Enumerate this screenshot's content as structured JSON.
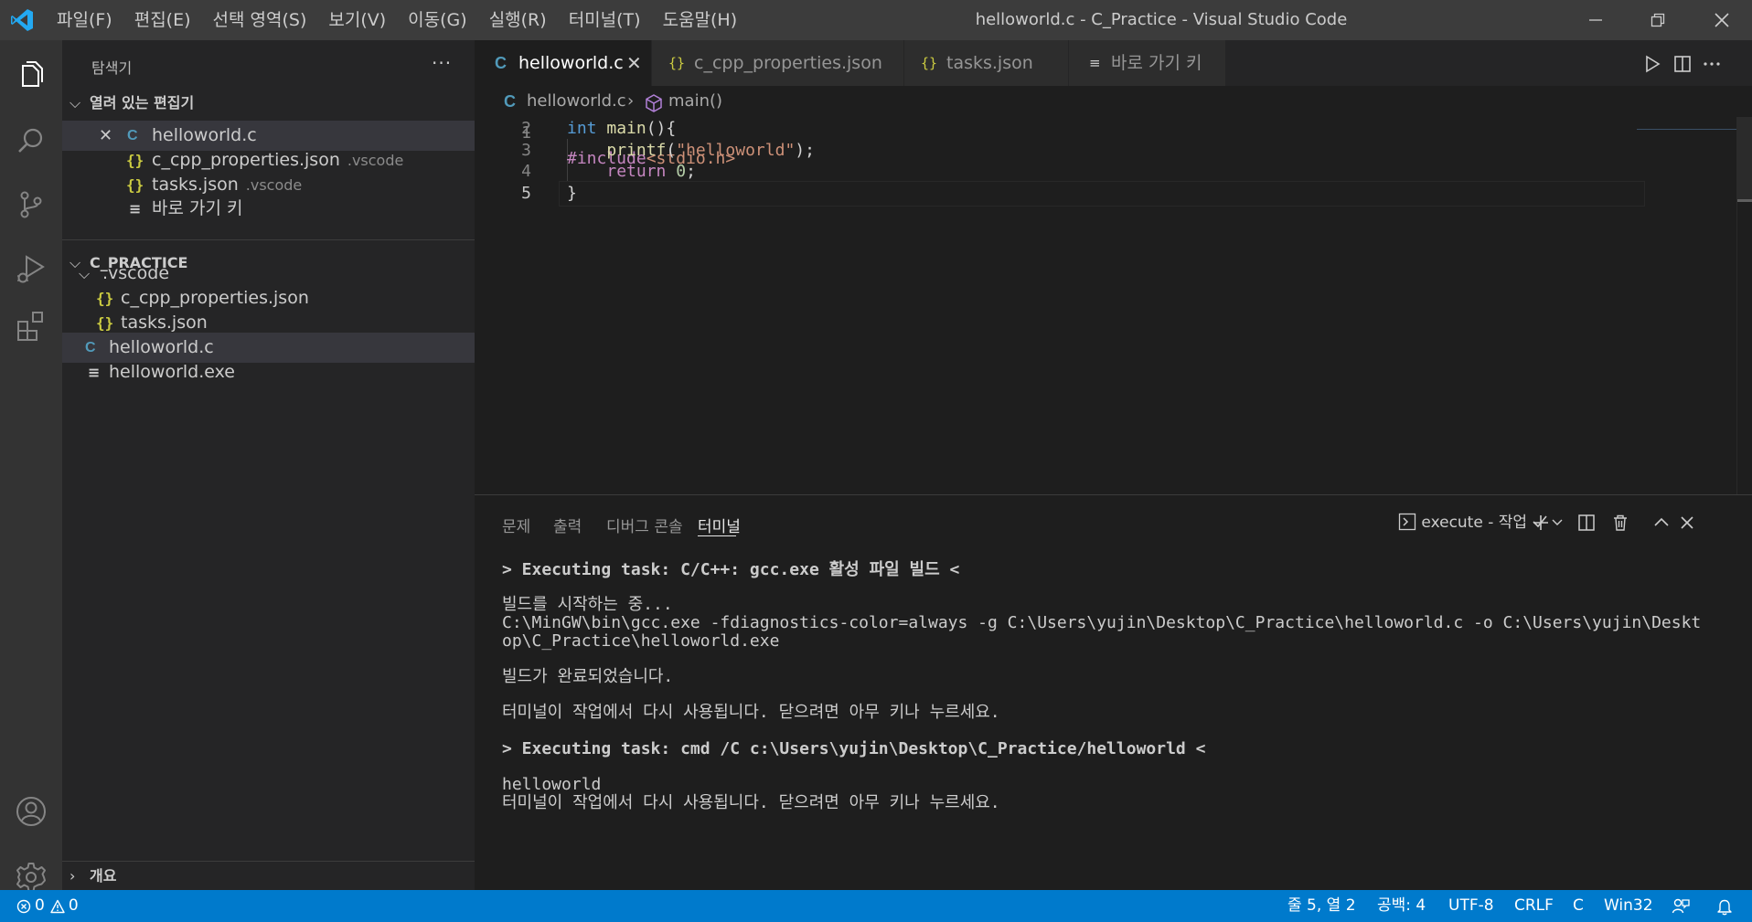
{
  "titlebar": {
    "menu": [
      "파일(F)",
      "편집(E)",
      "선택 영역(S)",
      "보기(V)",
      "이동(G)",
      "실행(R)",
      "터미널(T)",
      "도움말(H)"
    ],
    "window_title": "helloworld.c - C_Practice - Visual Studio Code",
    "buttons": [
      "minimize-icon",
      "restore-icon",
      "close-icon"
    ]
  },
  "activitybar": {
    "icons": [
      "files-icon",
      "search-icon",
      "source-control-icon",
      "run-debug-icon",
      "extensions-icon"
    ],
    "bottom_icons": [
      "account-icon",
      "settings-gear-icon"
    ]
  },
  "sidebar": {
    "title": "탐색기",
    "more": "···",
    "open_editors": {
      "header": "열려 있는 편집기",
      "items": [
        {
          "icon": "C",
          "label": "helloworld.c",
          "desc": ""
        },
        {
          "icon": "{}",
          "label": "c_cpp_properties.json",
          "desc": ".vscode"
        },
        {
          "icon": "{}",
          "label": "tasks.json",
          "desc": ".vscode"
        },
        {
          "icon": "≡",
          "label": "바로 가기 키",
          "desc": ""
        }
      ]
    },
    "workspace": {
      "header": "C_PRACTICE",
      "folder": ".vscode",
      "items": [
        {
          "icon": "{}",
          "label": "c_cpp_properties.json"
        },
        {
          "icon": "{}",
          "label": "tasks.json"
        },
        {
          "icon": "C",
          "label": "helloworld.c"
        },
        {
          "icon": "≡",
          "label": "helloworld.exe"
        }
      ]
    },
    "outline": {
      "header": "개요"
    }
  },
  "tabs": [
    {
      "icon": "C",
      "label": "helloworld.c",
      "active": true
    },
    {
      "icon": "{}",
      "label": "c_cpp_properties.json",
      "active": false
    },
    {
      "icon": "{}",
      "label": "tasks.json",
      "active": false
    },
    {
      "icon": "≡",
      "label": "바로 가기 키",
      "active": false
    }
  ],
  "editor_actions": [
    "run-icon",
    "split-editor-icon",
    "more-actions-icon"
  ],
  "breadcrumb": {
    "file": "helloworld.c",
    "symbol": "main()"
  },
  "code": {
    "line_numbers": [
      "1",
      "2",
      "3",
      "4",
      "5"
    ],
    "current_line": "5",
    "lines": {
      "l1": {
        "pp": "#include",
        "str": "<stdio.h>"
      },
      "l2": {
        "kw": "int",
        "fn": "main",
        "rest": "(){"
      },
      "l3": {
        "fn": "printf",
        "open": "(",
        "str": "\"helloworld\"",
        "close": ");"
      },
      "l4": {
        "kw": "return",
        "num": "0",
        "end": ";"
      },
      "l5": {
        "text": "}"
      }
    }
  },
  "panel": {
    "tabs": [
      "문제",
      "출력",
      "디버그 콘솔",
      "터미널"
    ],
    "active_tab": "터미널",
    "terminal_selector": "execute - 작업",
    "terminal_lines": [
      {
        "text": "> Executing task: C/C++: gcc.exe 활성 파일 빌드 <",
        "bold": true
      },
      {
        "text": "빌드를 시작하는 중...",
        "bold": false
      },
      {
        "text": "C:\\MinGW\\bin\\gcc.exe -fdiagnostics-color=always -g C:\\Users\\yujin\\Desktop\\C_Practice\\helloworld.c -o C:\\Users\\yujin\\Deskt",
        "bold": false
      },
      {
        "text": "op\\C_Practice\\helloworld.exe",
        "bold": false
      },
      {
        "text": "빌드가 완료되었습니다.",
        "bold": false
      },
      {
        "text": "터미널이 작업에서 다시 사용됩니다. 닫으려면 아무 키나 누르세요.",
        "bold": false
      },
      {
        "text": "> Executing task: cmd /C c:\\Users\\yujin\\Desktop\\C_Practice/helloworld <",
        "bold": true
      },
      {
        "text": "helloworld",
        "bold": false
      },
      {
        "text": "터미널이 작업에서 다시 사용됩니다. 닫으려면 아무 키나 누르세요.",
        "bold": false
      }
    ]
  },
  "statusbar": {
    "errors": "0",
    "warnings": "0",
    "position": "줄 5, 열 2",
    "spaces": "공백: 4",
    "encoding": "UTF-8",
    "eol": "CRLF",
    "language": "C",
    "platform": "Win32"
  },
  "colors": {
    "accent": "#007acc",
    "c_icon": "#519aba",
    "json_icon": "#cbcb41"
  }
}
